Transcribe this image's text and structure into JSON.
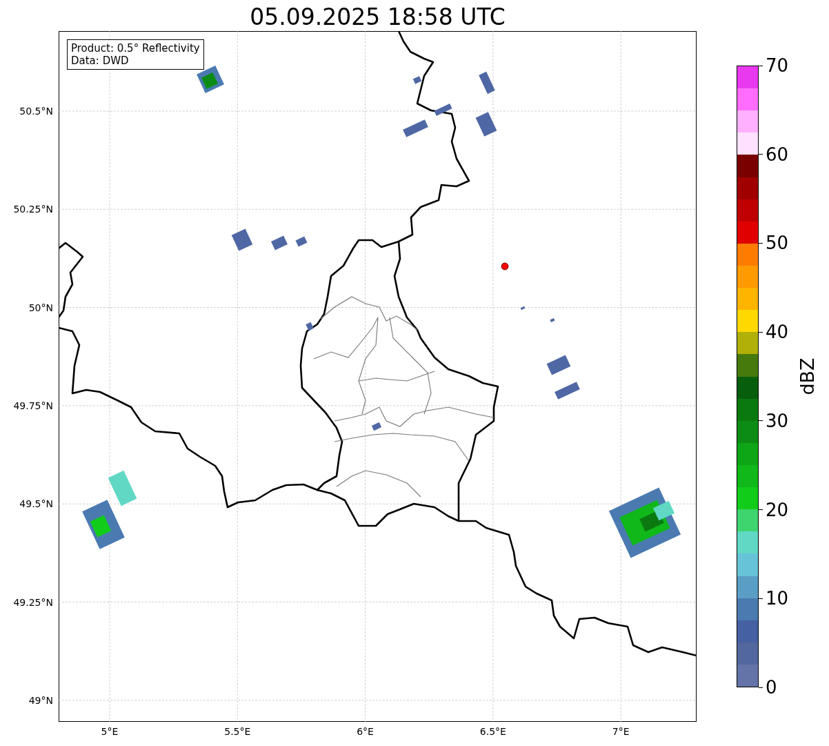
{
  "title": "05.09.2025 18:58 UTC",
  "legend": {
    "lines": [
      "Product: 0.5° Reflectivity",
      "Data: DWD"
    ]
  },
  "map": {
    "lat_ticks": [
      "50.5°N",
      "50.25°N",
      "50°N",
      "49.75°N",
      "49.5°N",
      "49.25°N",
      "49°N"
    ],
    "lon_ticks": [
      "5°E",
      "5.5°E",
      "6°E",
      "6.5°E",
      "7°E"
    ]
  },
  "colorbar": {
    "label": "dBZ",
    "ticks": [
      "70",
      "60",
      "50",
      "40",
      "30",
      "20",
      "10",
      "0"
    ],
    "bins": [
      {
        "color": "#e838f0"
      },
      {
        "color": "#ff6cff"
      },
      {
        "color": "#ffb0ff"
      },
      {
        "color": "#ffe0ff"
      },
      {
        "color": "#7a0000"
      },
      {
        "color": "#a00000"
      },
      {
        "color": "#c00000"
      },
      {
        "color": "#e00000"
      },
      {
        "color": "#ff7c00"
      },
      {
        "color": "#ff9a00"
      },
      {
        "color": "#ffb400"
      },
      {
        "color": "#ffd800"
      },
      {
        "color": "#b0b008"
      },
      {
        "color": "#467a0c"
      },
      {
        "color": "#075e0c"
      },
      {
        "color": "#0a7a10"
      },
      {
        "color": "#0c8c14"
      },
      {
        "color": "#0ea516"
      },
      {
        "color": "#10b81a"
      },
      {
        "color": "#12cc1a"
      },
      {
        "color": "#3ed46e"
      },
      {
        "color": "#60d8c4"
      },
      {
        "color": "#66c3d8"
      },
      {
        "color": "#5a9ec6"
      },
      {
        "color": "#4a7ab0"
      },
      {
        "color": "#4560a3"
      },
      {
        "color": "#52679e"
      },
      {
        "color": "#6473a8"
      }
    ]
  }
}
